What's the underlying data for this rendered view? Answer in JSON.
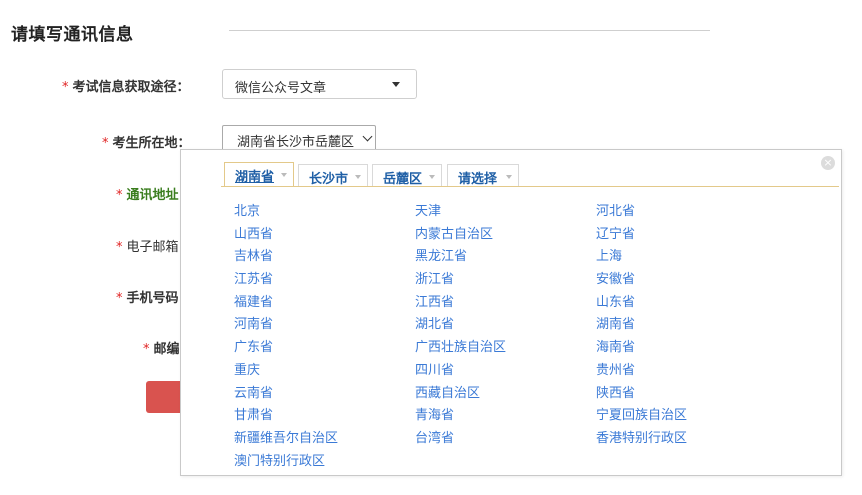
{
  "section": {
    "title": "请填写通讯信息"
  },
  "form": {
    "required_mark": "*",
    "exam_info": {
      "label": "考试信息获取途径：",
      "value": "微信公众号文章"
    },
    "location": {
      "label": "考生所在地：",
      "value": "湖南省长沙市岳麓区"
    },
    "address": {
      "label": "通讯地址"
    },
    "email": {
      "label": "电子邮箱"
    },
    "phone": {
      "label": "手机号码"
    },
    "postcode": {
      "label": "邮编"
    }
  },
  "popup": {
    "close_glyph": "×",
    "tabs": [
      {
        "label": "湖南省"
      },
      {
        "label": "长沙市"
      },
      {
        "label": "岳麓区"
      },
      {
        "label": "请选择"
      }
    ],
    "provinces": [
      "北京",
      "天津",
      "河北省",
      "山西省",
      "内蒙古自治区",
      "辽宁省",
      "吉林省",
      "黑龙江省",
      "上海",
      "江苏省",
      "浙江省",
      "安徽省",
      "福建省",
      "江西省",
      "山东省",
      "河南省",
      "湖北省",
      "湖南省",
      "广东省",
      "广西壮族自治区",
      "海南省",
      "重庆",
      "四川省",
      "贵州省",
      "云南省",
      "西藏自治区",
      "陕西省",
      "甘肃省",
      "青海省",
      "宁夏回族自治区",
      "新疆维吾尔自治区",
      "台湾省",
      "香港特别行政区",
      "澳门特别行政区"
    ]
  },
  "colors": {
    "required": "#e02222",
    "link": "#3b7ad6",
    "tab_text": "#1f5fa6",
    "accent_line": "#e3c98a",
    "submit_button": "#d9534f",
    "address_label": "#3a7d1e"
  }
}
